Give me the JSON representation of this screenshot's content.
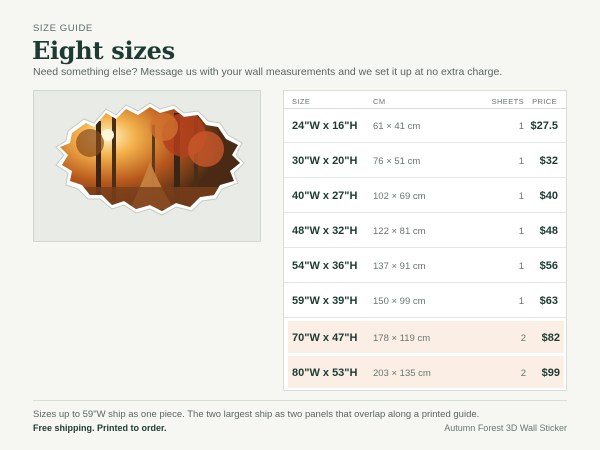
{
  "header": {
    "eyebrow": "SIZE GUIDE",
    "title": "Eight sizes",
    "subtitle": "Need something else? Message us with your wall measurements and we set it up at no extra charge."
  },
  "preview": {
    "icon": "forest-wall-sticker-image"
  },
  "table": {
    "headers": {
      "size": "SIZE",
      "cm": "CM",
      "sheets": "SHEETS",
      "price": "PRICE"
    },
    "rows": [
      {
        "size": "24\"W x 16\"H",
        "cm": "61 × 41 cm",
        "sheets": "1",
        "price": "$27.5",
        "highlight": false
      },
      {
        "size": "30\"W x 20\"H",
        "cm": "76 × 51 cm",
        "sheets": "1",
        "price": "$32",
        "highlight": false
      },
      {
        "size": "40\"W x 27\"H",
        "cm": "102 × 69 cm",
        "sheets": "1",
        "price": "$40",
        "highlight": false
      },
      {
        "size": "48\"W x 32\"H",
        "cm": "122 × 81 cm",
        "sheets": "1",
        "price": "$48",
        "highlight": false
      },
      {
        "size": "54\"W x 36\"H",
        "cm": "137 × 91 cm",
        "sheets": "1",
        "price": "$56",
        "highlight": false
      },
      {
        "size": "59\"W x 39\"H",
        "cm": "150 × 99 cm",
        "sheets": "1",
        "price": "$63",
        "highlight": false
      },
      {
        "size": "70\"W x 47\"H",
        "cm": "178 × 119 cm",
        "sheets": "2",
        "price": "$82",
        "highlight": true
      },
      {
        "size": "80\"W x 53\"H",
        "cm": "203 × 135 cm",
        "sheets": "2",
        "price": "$99",
        "highlight": true
      }
    ]
  },
  "footer": {
    "note": "Sizes up to 59\"W ship as one piece. The two largest ship as two panels that overlap along a printed guide.",
    "shipping": "Free shipping. Printed to order.",
    "product": "Autumn Forest 3D Wall Sticker"
  },
  "colors": {
    "background": "#f6f6f3",
    "text_dark": "#1d3b33",
    "highlight_row": "#fbeee4"
  }
}
